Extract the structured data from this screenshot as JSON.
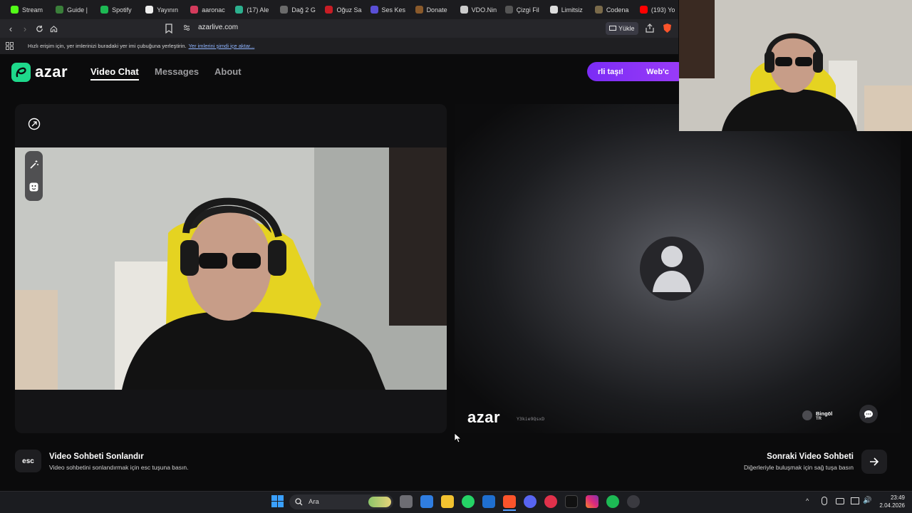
{
  "browser": {
    "bookmarks": [
      {
        "label": "Stream",
        "color": "#53fc18"
      },
      {
        "label": "Guide |",
        "color": "#3a7f3a"
      },
      {
        "label": "Spotify",
        "color": "#1db954"
      },
      {
        "label": "Yayının",
        "color": "#eeeeee"
      },
      {
        "label": "aaronac",
        "color": "#d43b5c"
      },
      {
        "label": "(17) Ale",
        "color": "#2cb08e"
      },
      {
        "label": "Dağ 2 G",
        "color": "#6b6b6b"
      },
      {
        "label": "Oğuz Sa",
        "color": "#c81d25"
      },
      {
        "label": "Ses Kes",
        "color": "#5a4fd6"
      },
      {
        "label": "Donate",
        "color": "#8a5a2b"
      },
      {
        "label": "VDO.Nin",
        "color": "#cccccc"
      },
      {
        "label": "Çizgi Fil",
        "color": "#555555"
      },
      {
        "label": "Limitsiz",
        "color": "#dddddd"
      },
      {
        "label": "Codena",
        "color": "#7a6a4a"
      },
      {
        "label": "(193) Yo",
        "color": "#ff0000"
      }
    ],
    "url": "azarlive.com",
    "upload_label": "Yükle",
    "infobar_text": "Hızlı erişim için, yer imlerinizi buradaki yer imi çubuğuna yerleştirin.",
    "infobar_link": "Yer imlerini şimdi içe aktar..."
  },
  "site": {
    "logo_text": "azar",
    "nav": {
      "video_chat": "Video Chat",
      "messages": "Messages",
      "about": "About"
    },
    "promo": {
      "part1": "rli taşı!",
      "part2": "Web'c"
    },
    "remote": {
      "logo_text": "azar",
      "user_id": "Y3kie9QsxD",
      "city": "Bingöl",
      "country": "TR"
    },
    "bottom": {
      "esc_key": "esc",
      "end_title": "Video Sohbeti Sonlandır",
      "end_subtitle": "Video sohbetini sonlandırmak için esc tuşuna basın.",
      "next_title": "Sonraki Video Sohbeti",
      "next_subtitle": "Diğerleriyle buluşmak için sağ tuşa basın"
    }
  },
  "taskbar": {
    "search_placeholder": "Ara",
    "time": "23:49",
    "date": "2.04.2026"
  }
}
